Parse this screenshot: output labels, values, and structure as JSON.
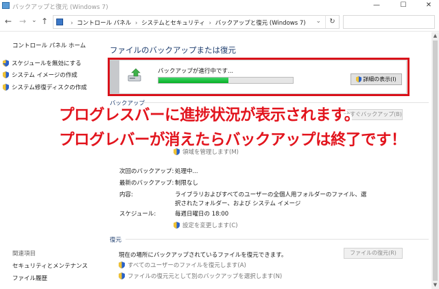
{
  "window": {
    "title": "バックアップと復元 (Windows 7)",
    "minimize_glyph": "—",
    "maximize_glyph": "☐",
    "close_glyph": "✕"
  },
  "nav": {
    "back_glyph": "←",
    "forward_glyph": "→",
    "history_glyph": "⌄",
    "up_glyph": "↑",
    "refresh_glyph": "↻",
    "address_dropdown_glyph": "⌄",
    "breadcrumbs": [
      "コントロール パネル",
      "システムとセキュリティ",
      "バックアップと復元 (Windows 7)"
    ],
    "separator": "›",
    "search_placeholder": ""
  },
  "sidebar": {
    "home": "コントロール パネル ホーム",
    "links": [
      "スケジュールを無効にする",
      "システム イメージの作成",
      "システム修復ディスクの作成"
    ],
    "related_heading": "関連項目",
    "related_links": [
      "セキュリティとメンテナンス",
      "ファイル履歴"
    ]
  },
  "main": {
    "title": "ファイルのバックアップまたは復元",
    "progress": {
      "message": "バックアップが進行中です...",
      "fraction": 0.52,
      "detail_button": "詳細の表示(I)"
    },
    "backup": {
      "heading": "バックアップ",
      "backup_now_button": "今すぐバックアップ(B)",
      "manage_space_link": "領域を管理します(M)",
      "info": [
        {
          "label": "次回のバックアップ:",
          "value": "処理中..."
        },
        {
          "label": "最新のバックアップ:",
          "value": "制限なし"
        },
        {
          "label": "内容:",
          "value": "ライブラリおよびすべてのユーザーの全個人用フォルダーのファイル、選"
        },
        {
          "label": "",
          "value": "択されたフォルダー、および システム イメージ"
        },
        {
          "label": "スケジュール:",
          "value": "毎週日曜日の 18:00"
        }
      ],
      "change_settings_link": "設定を変更します(C)"
    },
    "restore": {
      "heading": "復元",
      "description": "現在の場所にバックアップされているファイルを復元できます。",
      "restore_files_button": "ファイルの復元(R)",
      "restore_all_users_link": "すべてのユーザーのファイルを復元します(A)",
      "select_other_link": "ファイルの復元元として別のバックアップを選択します(N)"
    }
  },
  "annotation": {
    "line1": "プログレスバーに進捗状況が表示されます。",
    "line2": "プログレバーが消えたらバックアップは終了です！",
    "color": "#e2141d"
  },
  "colors": {
    "heading_blue": "#1e3d6e",
    "progress_green": "#06b025",
    "highlight_red": "#d9111a"
  }
}
